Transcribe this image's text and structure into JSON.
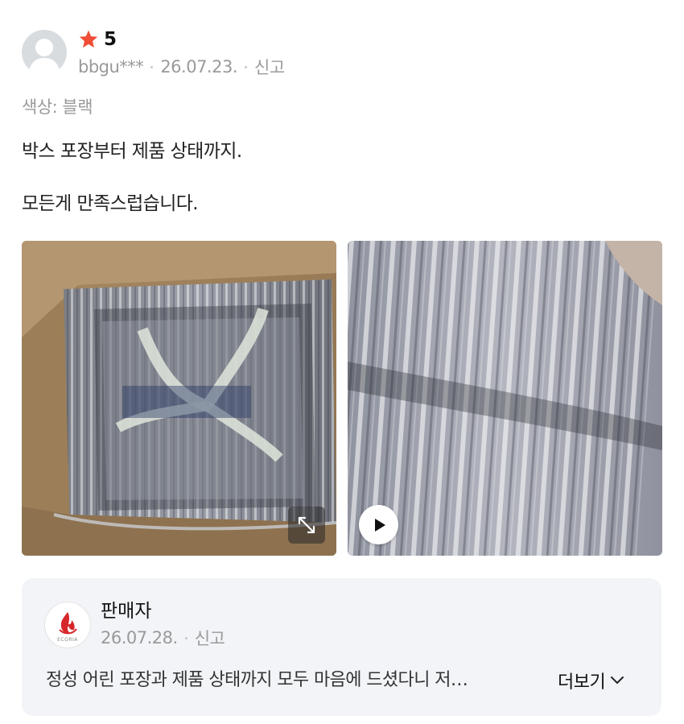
{
  "review": {
    "rating": "5",
    "author": "bbgu***",
    "date": "26.07.23.",
    "report_label": "신고",
    "option": "색상: 블랙",
    "text_lines": [
      "박스 포장부터 제품 상태까지.",
      "모든게 만족스럽습니다."
    ],
    "photos": [
      {
        "icon": "expand-icon"
      },
      {
        "icon": "play-icon"
      }
    ]
  },
  "seller_reply": {
    "name": "판매자",
    "date": "26.07.28.",
    "report_label": "신고",
    "text": "정성 어린 포장과 제품 상태까지 모두 마음에 드셨다니 저…",
    "more_label": "더보기",
    "logo_text": "ECORIA"
  },
  "colors": {
    "star": "#f04e37",
    "meta_text": "#9a9a9a",
    "reply_bg": "#f2f4f7",
    "logo_red": "#d6282b"
  }
}
